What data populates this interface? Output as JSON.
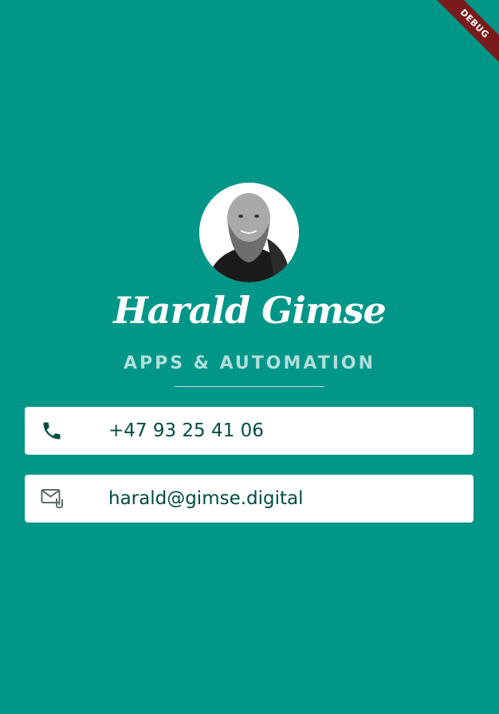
{
  "debug_banner": {
    "label": "DEBUG"
  },
  "profile": {
    "name": "Harald Gimse",
    "title": "APPS & AUTOMATION"
  },
  "contacts": {
    "phone": {
      "icon": "phone-icon",
      "value": "+47 93 25 41 06"
    },
    "email": {
      "icon": "mail-attachment-icon",
      "value": "harald@gimse.digital"
    }
  },
  "colors": {
    "background": "#009688",
    "card": "#ffffff",
    "text": "#004d40",
    "subtitle": "#b2dfdb",
    "banner": "#7a1b1b"
  }
}
